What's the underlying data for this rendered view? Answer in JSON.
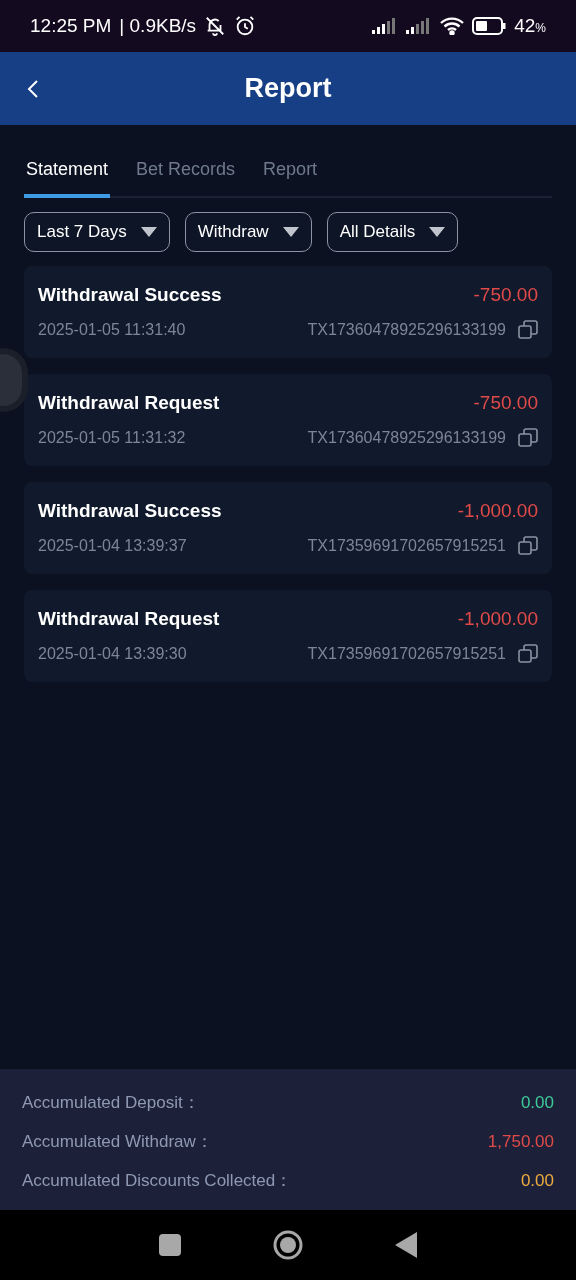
{
  "status_bar": {
    "time": "12:25 PM",
    "speed": "| 0.9KB/s",
    "battery": "42",
    "battery_unit": "%"
  },
  "header": {
    "title": "Report"
  },
  "tabs": [
    {
      "label": "Statement",
      "selected": true
    },
    {
      "label": "Bet Records",
      "selected": false
    },
    {
      "label": "Report",
      "selected": false
    }
  ],
  "filters": [
    {
      "label": "Last 7 Days"
    },
    {
      "label": "Withdraw"
    },
    {
      "label": "All Details"
    }
  ],
  "records": [
    {
      "title": "Withdrawal Success",
      "amount": "-750.00",
      "time": "2025-01-05 11:31:40",
      "tx": "TX17360478925296133199"
    },
    {
      "title": "Withdrawal Request",
      "amount": "-750.00",
      "time": "2025-01-05 11:31:32",
      "tx": "TX17360478925296133199"
    },
    {
      "title": "Withdrawal Success",
      "amount": "-1,000.00",
      "time": "2025-01-04 13:39:37",
      "tx": "TX17359691702657915251"
    },
    {
      "title": "Withdrawal Request",
      "amount": "-1,000.00",
      "time": "2025-01-04 13:39:30",
      "tx": "TX17359691702657915251"
    }
  ],
  "summary": [
    {
      "label": "Accumulated Deposit：",
      "value": "0.00",
      "color": "#3ec99a"
    },
    {
      "label": "Accumulated Withdraw：",
      "value": "1,750.00",
      "color": "#e04a48"
    },
    {
      "label": "Accumulated Discounts Collected：",
      "value": "0.00",
      "color": "#efaa3e"
    }
  ]
}
